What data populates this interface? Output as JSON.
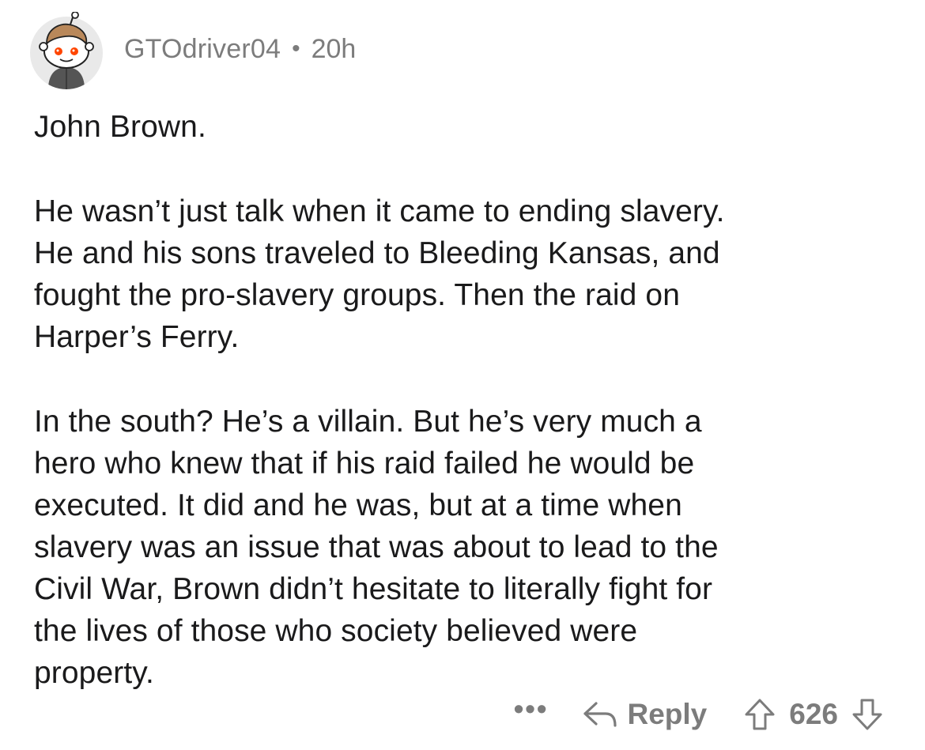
{
  "comment": {
    "username": "GTOdriver04",
    "separator": "•",
    "age": "20h",
    "paragraphs": [
      "John Brown.",
      "He wasn’t just talk when it came to ending slavery.\nHe and his sons traveled to Bleeding Kansas, and\nfought the pro-slavery groups. Then the raid on\nHarper’s Ferry.",
      "In the south? He’s a villain. But he’s very much a\nhero who knew that if his raid failed he would be\nexecuted. It did and he was, but at a time when\nslavery was an issue that was about to lead to the\nCivil War, Brown didn’t hesitate to literally fight for\nthe lives of those who society believed were\nproperty."
    ]
  },
  "actions": {
    "more_label": "•••",
    "reply_label": "Reply",
    "score": "626"
  },
  "icons": {
    "avatar": "reddit-snoo-avatar-icon",
    "reply": "reply-arrow-icon",
    "upvote": "upvote-arrow-icon",
    "downvote": "downvote-arrow-icon"
  },
  "colors": {
    "text": "#1a1a1b",
    "muted": "#7c7c7c",
    "avatar_bg": "#e9e9e9",
    "snoo_eye": "#ff4500",
    "hair": "#b9885a"
  }
}
